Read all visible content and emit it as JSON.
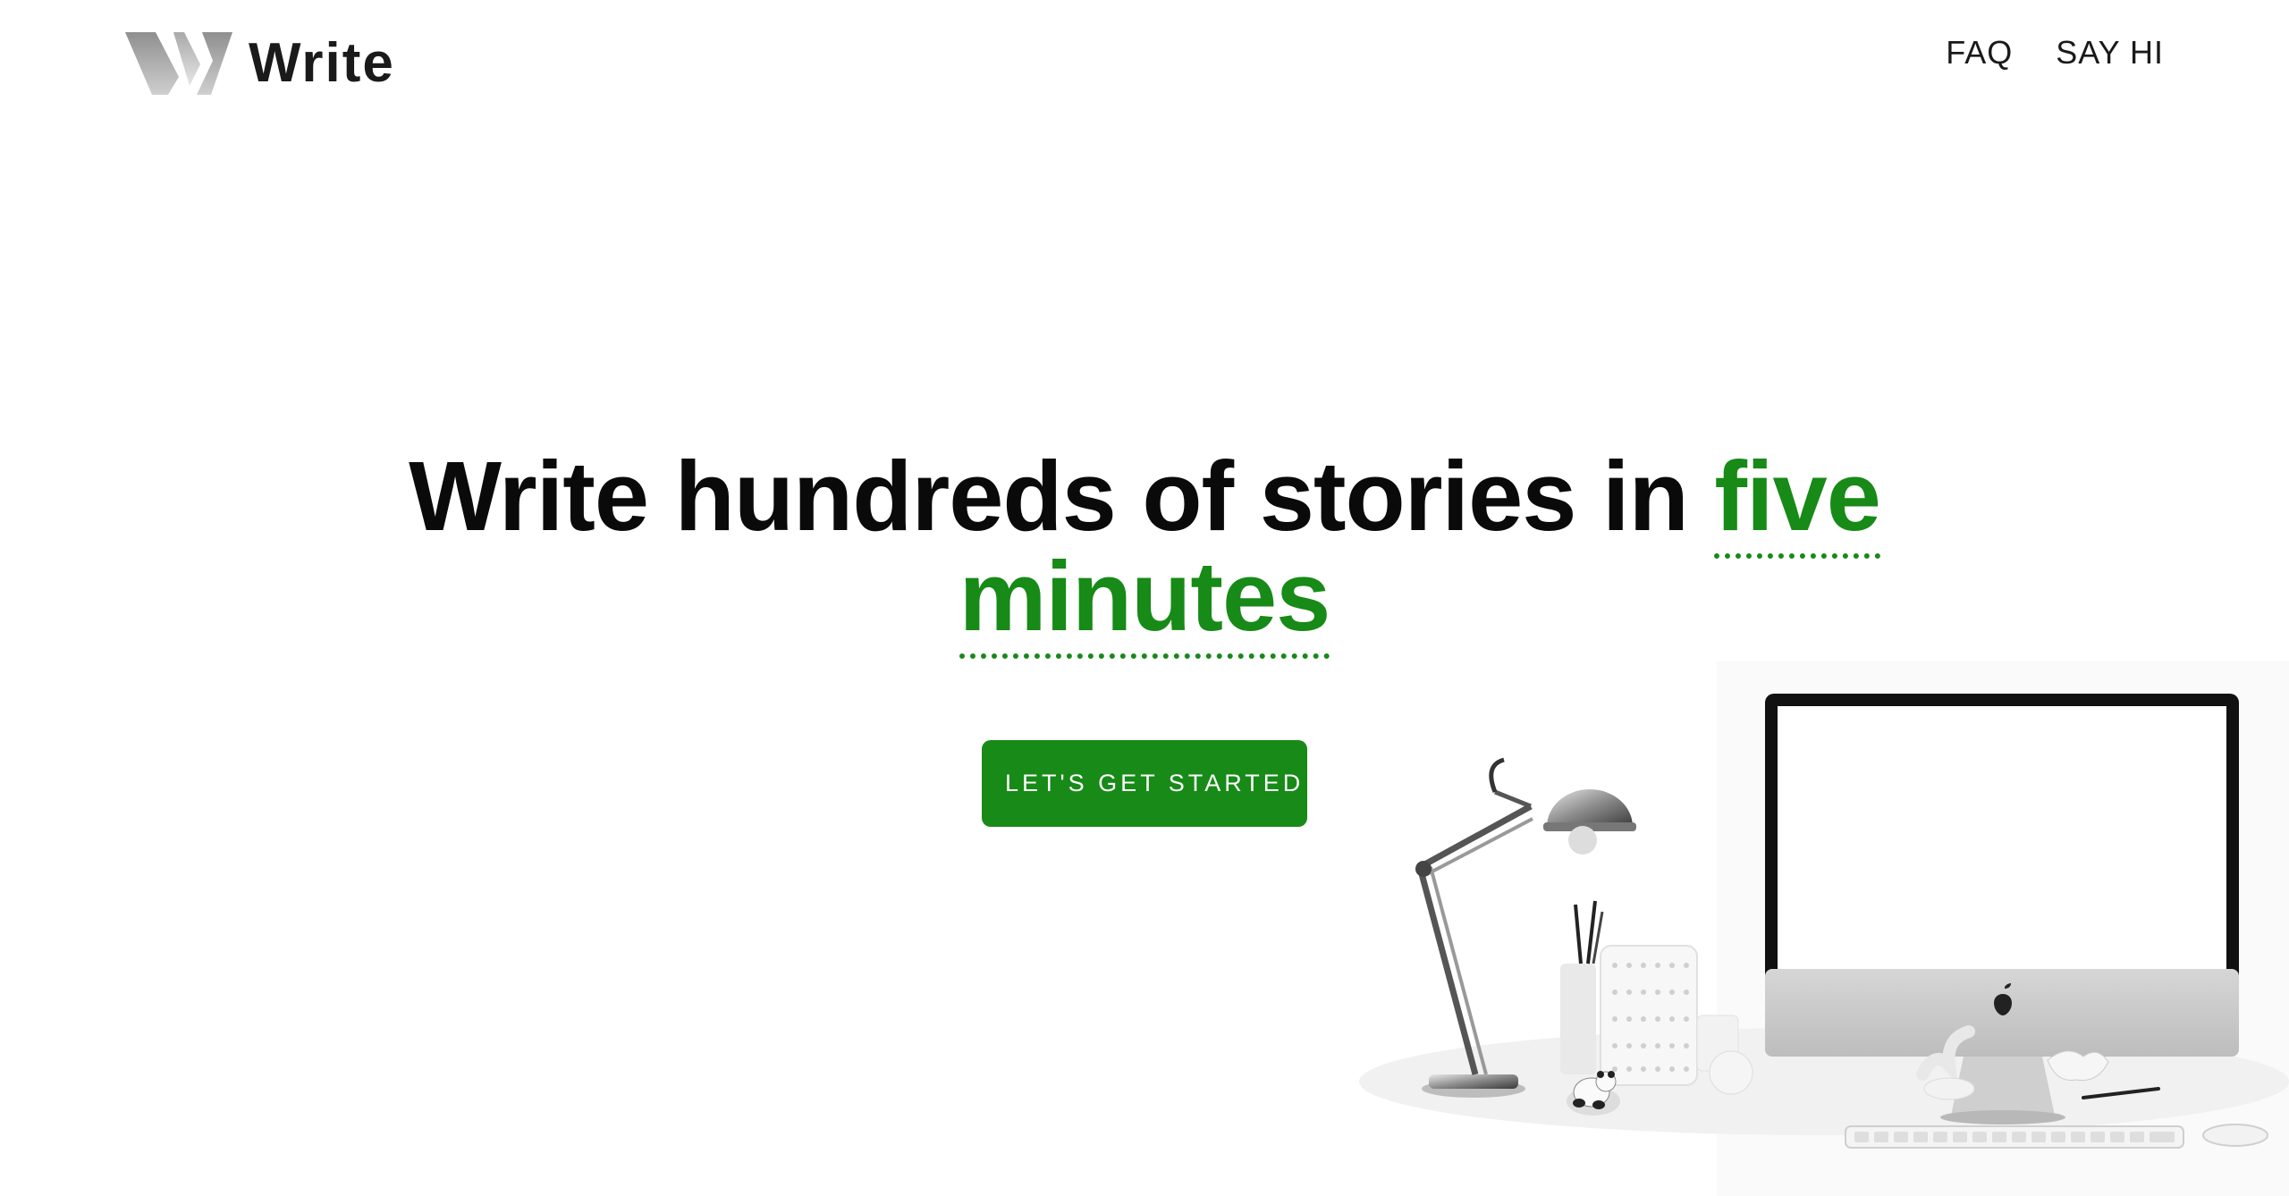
{
  "header": {
    "logo_text": "Write",
    "logo_icon": "w-logo-icon",
    "nav": [
      {
        "label": "FAQ"
      },
      {
        "label": "SAY HI"
      }
    ]
  },
  "hero": {
    "headline_main": "Write hundreds of stories in ",
    "headline_accent_1": "five",
    "headline_accent_2": "minutes",
    "cta_label": "LET'S GET STARTED"
  },
  "colors": {
    "accent": "#178a17",
    "text": "#0a0a0a",
    "background": "#ffffff"
  },
  "illustration": {
    "description_icon": "desk-workspace-icon"
  }
}
